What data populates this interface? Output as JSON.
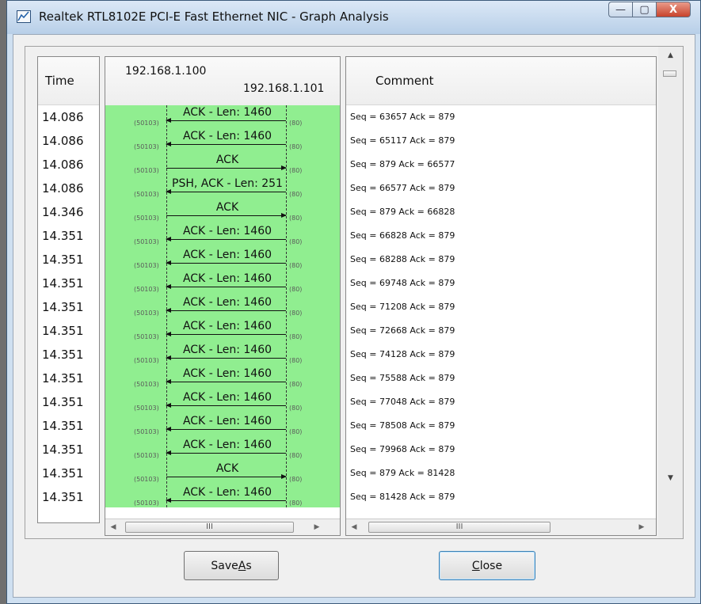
{
  "window": {
    "title": "Realtek RTL8102E PCI-E Fast Ethernet NIC - Graph Analysis"
  },
  "title_buttons": {
    "minimize": "—",
    "maximize": "▢",
    "close": "X"
  },
  "columns": {
    "time_header": "Time",
    "graph_header_left": "192.168.1.100",
    "graph_header_right": "192.168.1.101",
    "comment_header": "Comment"
  },
  "rows": [
    {
      "time": "14.086",
      "label": "ACK - Len: 1460",
      "direction": "left",
      "left_port": "(50103)",
      "right_port": "(80)",
      "comment": "Seq = 63657 Ack = 879"
    },
    {
      "time": "14.086",
      "label": "ACK - Len: 1460",
      "direction": "left",
      "left_port": "(50103)",
      "right_port": "(80)",
      "comment": "Seq = 65117 Ack = 879"
    },
    {
      "time": "14.086",
      "label": "ACK",
      "direction": "right",
      "left_port": "(50103)",
      "right_port": "(80)",
      "comment": "Seq = 879 Ack = 66577"
    },
    {
      "time": "14.086",
      "label": "PSH, ACK - Len: 251",
      "direction": "left",
      "left_port": "(50103)",
      "right_port": "(80)",
      "comment": "Seq = 66577 Ack = 879"
    },
    {
      "time": "14.346",
      "label": "ACK",
      "direction": "right",
      "left_port": "(50103)",
      "right_port": "(80)",
      "comment": "Seq = 879 Ack = 66828"
    },
    {
      "time": "14.351",
      "label": "ACK - Len: 1460",
      "direction": "left",
      "left_port": "(50103)",
      "right_port": "(80)",
      "comment": "Seq = 66828 Ack = 879"
    },
    {
      "time": "14.351",
      "label": "ACK - Len: 1460",
      "direction": "left",
      "left_port": "(50103)",
      "right_port": "(80)",
      "comment": "Seq = 68288 Ack = 879"
    },
    {
      "time": "14.351",
      "label": "ACK - Len: 1460",
      "direction": "left",
      "left_port": "(50103)",
      "right_port": "(80)",
      "comment": "Seq = 69748 Ack = 879"
    },
    {
      "time": "14.351",
      "label": "ACK - Len: 1460",
      "direction": "left",
      "left_port": "(50103)",
      "right_port": "(80)",
      "comment": "Seq = 71208 Ack = 879"
    },
    {
      "time": "14.351",
      "label": "ACK - Len: 1460",
      "direction": "left",
      "left_port": "(50103)",
      "right_port": "(80)",
      "comment": "Seq = 72668 Ack = 879"
    },
    {
      "time": "14.351",
      "label": "ACK - Len: 1460",
      "direction": "left",
      "left_port": "(50103)",
      "right_port": "(80)",
      "comment": "Seq = 74128 Ack = 879"
    },
    {
      "time": "14.351",
      "label": "ACK - Len: 1460",
      "direction": "left",
      "left_port": "(50103)",
      "right_port": "(80)",
      "comment": "Seq = 75588 Ack = 879"
    },
    {
      "time": "14.351",
      "label": "ACK - Len: 1460",
      "direction": "left",
      "left_port": "(50103)",
      "right_port": "(80)",
      "comment": "Seq = 77048 Ack = 879"
    },
    {
      "time": "14.351",
      "label": "ACK - Len: 1460",
      "direction": "left",
      "left_port": "(50103)",
      "right_port": "(80)",
      "comment": "Seq = 78508 Ack = 879"
    },
    {
      "time": "14.351",
      "label": "ACK - Len: 1460",
      "direction": "left",
      "left_port": "(50103)",
      "right_port": "(80)",
      "comment": "Seq = 79968 Ack = 879"
    },
    {
      "time": "14.351",
      "label": "ACK",
      "direction": "right",
      "left_port": "(50103)",
      "right_port": "(80)",
      "comment": "Seq = 879 Ack = 81428"
    },
    {
      "time": "14.351",
      "label": "ACK - Len: 1460",
      "direction": "left",
      "left_port": "(50103)",
      "right_port": "(80)",
      "comment": "Seq = 81428 Ack = 879"
    }
  ],
  "scrollbars": {
    "thumb_grip": "III",
    "arrow_left": "◀",
    "arrow_right": "▶",
    "arrow_up": "▲",
    "arrow_down": "▼"
  },
  "buttons": {
    "save_as": {
      "before": "Save ",
      "mnemonic": "A",
      "after": "s"
    },
    "close": {
      "before": "",
      "mnemonic": "C",
      "after": "lose"
    }
  },
  "colors": {
    "graph_background": "#90ee90"
  },
  "icons": {
    "app": "graph-analysis-icon"
  }
}
